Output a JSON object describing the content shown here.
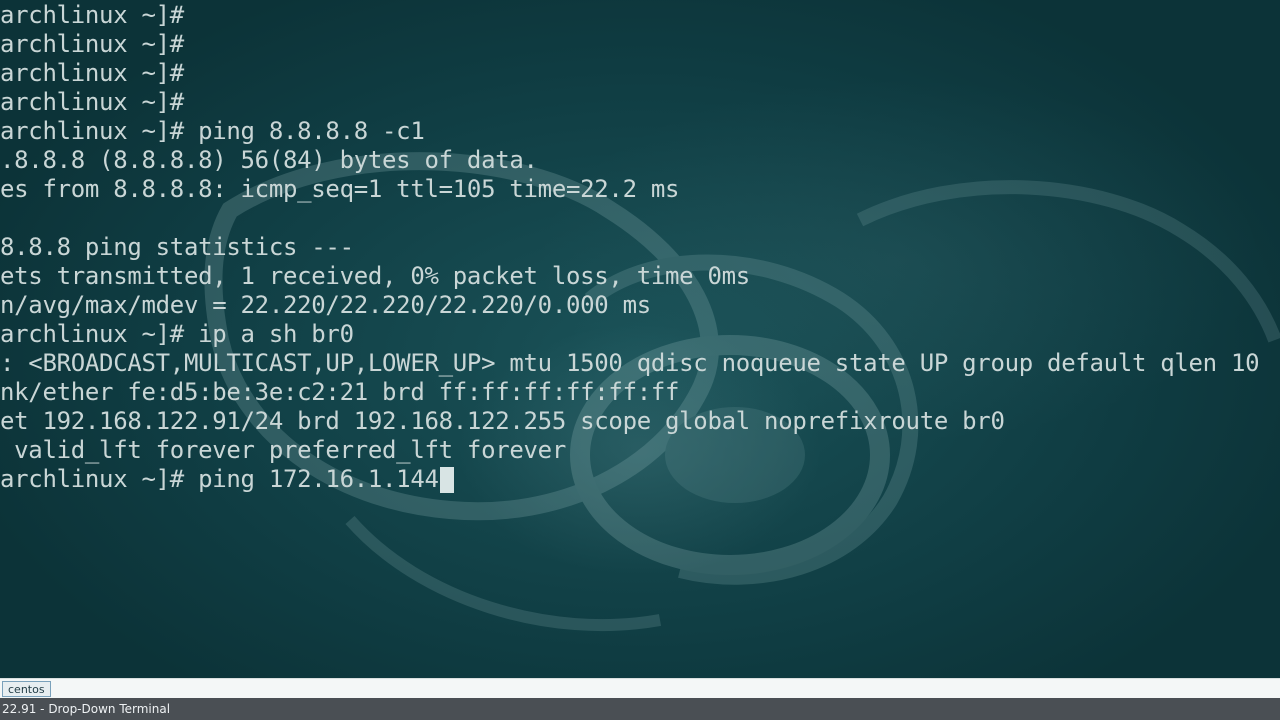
{
  "terminal": {
    "lines": [
      "archlinux ~]#",
      "archlinux ~]#",
      "archlinux ~]#",
      "archlinux ~]#",
      "archlinux ~]# ping 8.8.8.8 -c1",
      ".8.8.8 (8.8.8.8) 56(84) bytes of data.",
      "es from 8.8.8.8: icmp_seq=1 ttl=105 time=22.2 ms",
      "",
      "8.8.8 ping statistics ---",
      "ets transmitted, 1 received, 0% packet loss, time 0ms",
      "n/avg/max/mdev = 22.220/22.220/22.220/0.000 ms",
      "archlinux ~]# ip a sh br0",
      ": <BROADCAST,MULTICAST,UP,LOWER_UP> mtu 1500 qdisc noqueue state UP group default qlen 10",
      "nk/ether fe:d5:be:3e:c2:21 brd ff:ff:ff:ff:ff:ff",
      "et 192.168.122.91/24 brd 192.168.122.255 scope global noprefixroute br0",
      " valid_lft forever preferred_lft forever",
      "archlinux ~]# ping 172.16.1.144"
    ]
  },
  "tabbar": {
    "tab_label": "centos"
  },
  "window": {
    "title": "22.91 - Drop-Down Terminal"
  },
  "colors": {
    "background": "#0f3c42",
    "text": "#c9d6d6",
    "titlebar": "#4a4f54"
  }
}
